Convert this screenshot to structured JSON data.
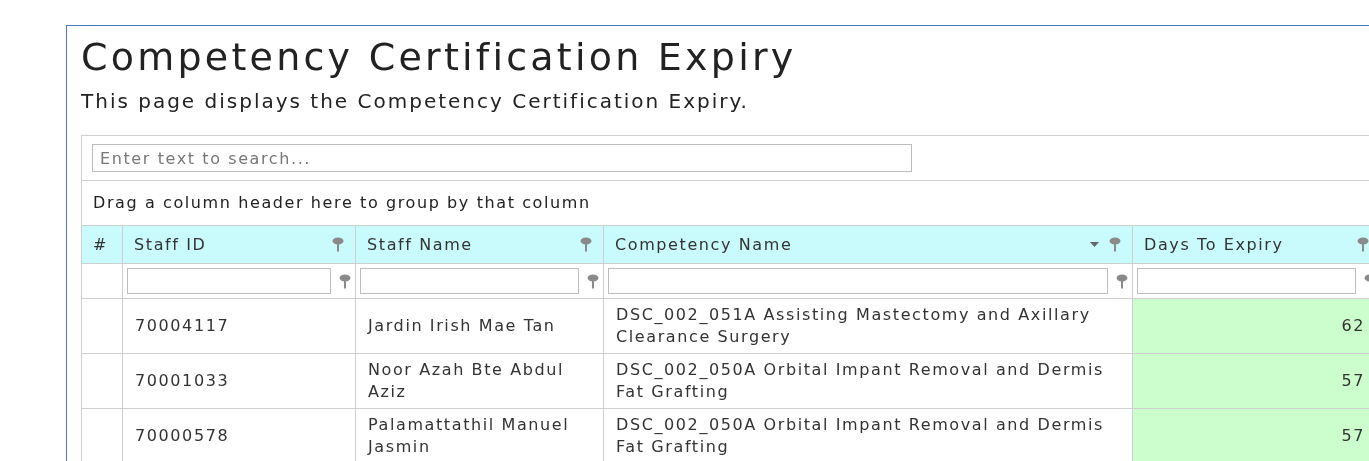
{
  "page": {
    "title": "Competency Certification Expiry",
    "description": "This page displays the Competency Certification Expiry."
  },
  "grid": {
    "search": {
      "placeholder": "Enter text to search..."
    },
    "group_panel": "Drag a column header here to group by that column",
    "columns": [
      {
        "label": "#",
        "filterable": false,
        "sorted": false
      },
      {
        "label": "Staff ID",
        "filterable": true,
        "sorted": false
      },
      {
        "label": "Staff Name",
        "filterable": true,
        "sorted": false
      },
      {
        "label": "Competency Name",
        "filterable": true,
        "sorted": true
      },
      {
        "label": "Days To Expiry",
        "filterable": true,
        "sorted": false
      }
    ],
    "rows": [
      {
        "number": "",
        "staff_id": "70004117",
        "staff_name": "Jardin Irish Mae Tan",
        "competency": "DSC_002_051A Assisting Mastectomy and Axillary Clearance Surgery",
        "days": "62",
        "highlighted": true
      },
      {
        "number": "",
        "staff_id": "70001033",
        "staff_name": "Noor Azah Bte Abdul Aziz",
        "competency": "DSC_002_050A Orbital Impant Removal and Dermis Fat Grafting",
        "days": "57",
        "highlighted": true
      },
      {
        "number": "",
        "staff_id": "70000578",
        "staff_name": "Palamattathil Manuel Jasmin",
        "competency": "DSC_002_050A Orbital Impant Removal and Dermis Fat Grafting",
        "days": "57",
        "highlighted": true
      }
    ]
  }
}
